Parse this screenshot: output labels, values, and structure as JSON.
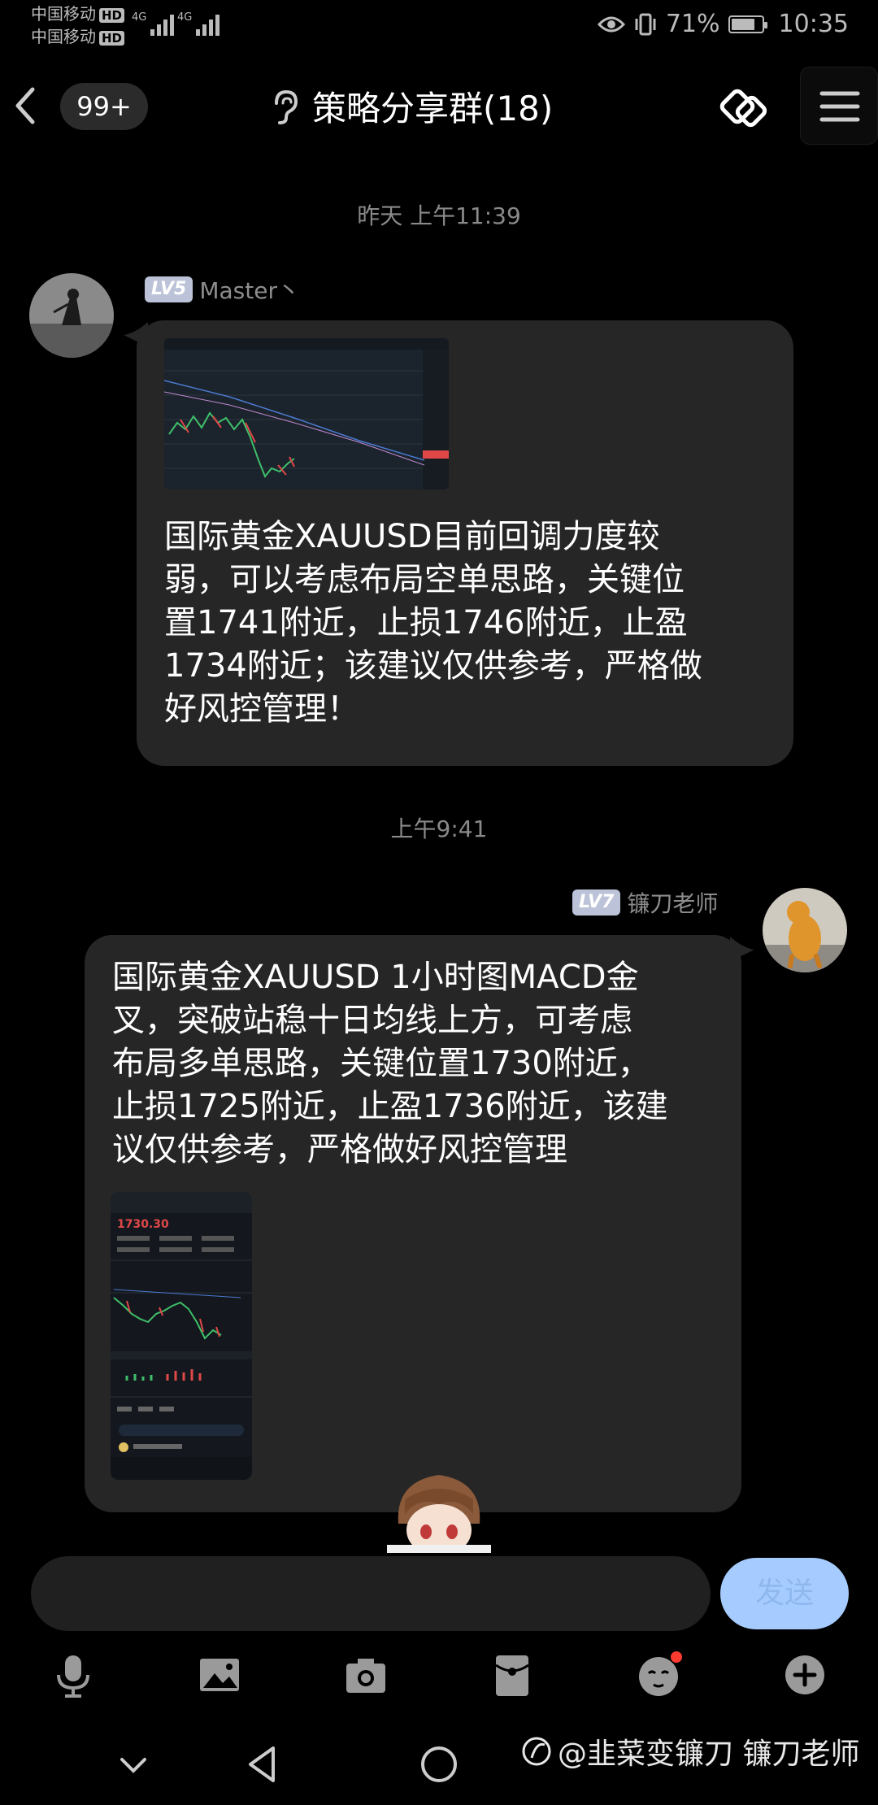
{
  "status_bar": {
    "carrier1": "中国移动",
    "carrier2": "中国移动",
    "hd": "HD",
    "net1": "4G",
    "net2": "4G",
    "battery": "71%",
    "time": "10:35"
  },
  "header": {
    "unread_badge": "99+",
    "title": "策略分享群(18)"
  },
  "messages": [
    {
      "timestamp": "昨天 上午11:39",
      "level": "LV5",
      "sender": "Master丶",
      "text": "国际黄金XAUUSD目前回调力度较弱，可以考虑布局空单思路，关键位置1741附近，止损1746附近，止盈1734附近；该建议仅供参考，严格做好风控管理！",
      "lines": [
        "国际黄金XAUUSD目前回调力度较",
        "弱，可以考虑布局空单思路，关键位",
        "置1741附近，止损1746附近，止盈",
        "1734附近；该建议仅供参考，严格做",
        "好风控管理！"
      ]
    },
    {
      "timestamp": "上午9:41",
      "level": "LV7",
      "sender": "镰刀老师",
      "text": "国际黄金XAUUSD 1小时图MACD金叉，突破站稳十日均线上方，可考虑布局多单思路，关键位置1730附近，止损1725附近，止盈1736附近，该建议仅供参考，严格做好风控管理",
      "lines": [
        "国际黄金XAUUSD 1小时图MACD金",
        "叉，突破站稳十日均线上方，可考虑",
        "布局多单思路，关键位置1730附近，",
        "止损1725附近，止盈1736附近，该建",
        "议仅供参考，严格做好风控管理"
      ],
      "thumb_price": "1730.30"
    }
  ],
  "input": {
    "send_label": "发送"
  },
  "watermark": "@韭菜变镰刀 镰刀老师",
  "colors": {
    "background": "#000000",
    "bubble": "#262626",
    "send_button": "#a6ccff",
    "level_badge": "#bcc3d8",
    "notification_dot": "#ff3b30"
  },
  "icons": [
    "back-icon",
    "ear-icon",
    "share-link-icon",
    "menu-icon",
    "mic-icon",
    "image-icon",
    "camera-icon",
    "red-packet-icon",
    "emoji-icon",
    "plus-icon",
    "nav-back-icon",
    "nav-home-icon",
    "nav-collapse-icon"
  ]
}
